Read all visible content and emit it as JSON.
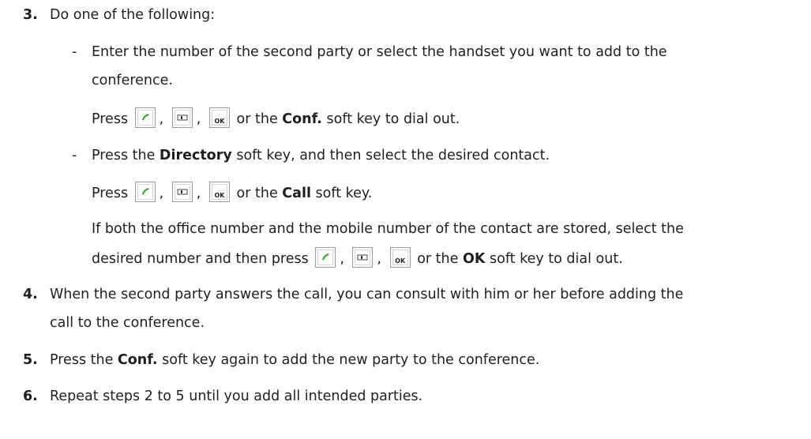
{
  "steps": {
    "s3": {
      "number": "3.",
      "lead": "Do one of the following:",
      "option1": {
        "dash": "-",
        "line1": "Enter the number of the second party or select the handset you want to add to the",
        "line2": "conference.",
        "press_pre": "Press",
        "comma": ",",
        "or_the": "or the",
        "key_label": "Conf.",
        "press_post": "soft key to dial out."
      },
      "option2": {
        "dash": "-",
        "pre": "Press the",
        "key_label": "Directory",
        "post": "soft key, and then select the desired contact.",
        "press_pre": "Press",
        "comma": ",",
        "or_the": "or the",
        "call_label": "Call",
        "press_post": "soft key.",
        "both_line1": "If both the office number and the mobile number of the contact are stored, select the",
        "both_line2_pre": "desired number and then press",
        "comma2": ",",
        "or_the2": "or the",
        "ok_label": "OK",
        "both_line2_post": "soft key to dial out."
      }
    },
    "s4": {
      "number": "4.",
      "line1": "When the second party answers the call, you can consult with him or her before adding the",
      "line2": "call to the conference."
    },
    "s5": {
      "number": "5.",
      "pre": "Press the",
      "key_label": "Conf.",
      "post": "soft key again to add the new party to the conference."
    },
    "s6": {
      "number": "6.",
      "text": "Repeat steps 2 to 5 until you add all intended parties."
    }
  },
  "icons": {
    "handset_key": "green-handset-icon",
    "speaker_key": "speaker-icon",
    "ok_key": "ok-key-icon",
    "ok_key_text": "OK",
    "handset_color": "#2fa02f"
  }
}
